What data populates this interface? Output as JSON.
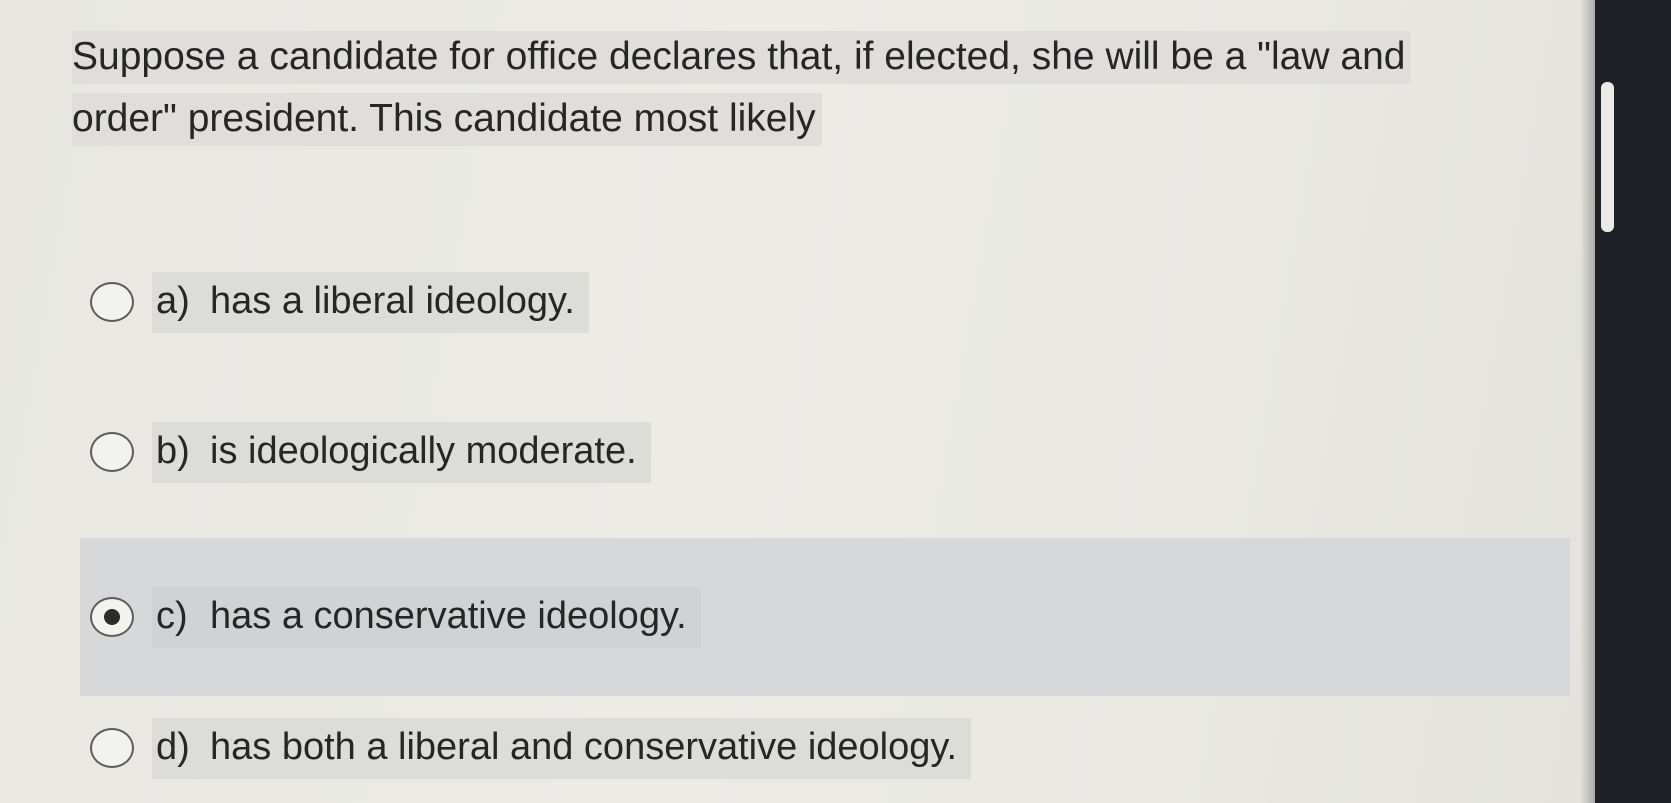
{
  "question": {
    "line1": "Suppose a candidate for office declares that, if elected, she will be a \"law and",
    "line2": "order\" president. This candidate most likely"
  },
  "options": [
    {
      "letter": "a)",
      "text": "has a liberal ideology.",
      "selected": false
    },
    {
      "letter": "b)",
      "text": "is ideologically moderate.",
      "selected": false
    },
    {
      "letter": "c)",
      "text": "has a conservative ideology.",
      "selected": true
    },
    {
      "letter": "d)",
      "text": "has both a liberal and conservative ideology.",
      "selected": false
    }
  ],
  "colors": {
    "selected_background": "#d6d8d9",
    "text_highlight": "#dcdcd9",
    "bezel": "#1d2024"
  }
}
